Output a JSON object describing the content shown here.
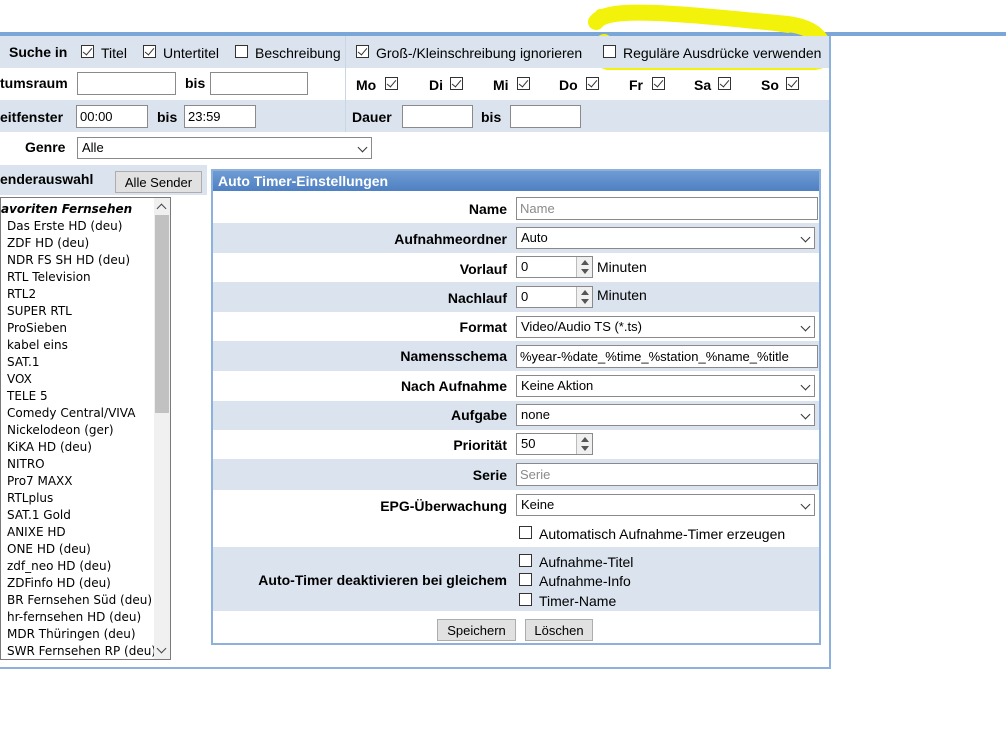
{
  "search": {
    "label": "Suche in",
    "options": [
      {
        "label": "Titel",
        "checked": true
      },
      {
        "label": "Untertitel",
        "checked": true
      },
      {
        "label": "Beschreibung",
        "checked": false
      }
    ],
    "case_label": "Groß-/Kleinschreibung ignorieren",
    "case_checked": true,
    "regex_label": "Reguläre Ausdrücke verwenden",
    "regex_checked": false
  },
  "date_range": {
    "label": "tumsraum",
    "to_label": "bis",
    "from_value": "",
    "to_value": ""
  },
  "weekdays": [
    {
      "label": "Mo",
      "checked": true
    },
    {
      "label": "Di",
      "checked": true
    },
    {
      "label": "Mi",
      "checked": true
    },
    {
      "label": "Do",
      "checked": true
    },
    {
      "label": "Fr",
      "checked": true
    },
    {
      "label": "Sa",
      "checked": true
    },
    {
      "label": "So",
      "checked": true
    }
  ],
  "time_window": {
    "label": "eitfenster",
    "from_value": "00:00",
    "to_label": "bis",
    "to_value": "23:59"
  },
  "duration": {
    "label": "Dauer",
    "to_label": "bis",
    "from_value": "",
    "to_value": ""
  },
  "genre": {
    "label": "Genre",
    "value": "Alle"
  },
  "channels": {
    "label": "enderauswahl",
    "all_button": "Alle Sender",
    "group": "avoriten Fernsehen",
    "items": [
      "Das Erste HD (deu)",
      "ZDF HD (deu)",
      "NDR FS SH HD (deu)",
      "RTL Television",
      "RTL2",
      "SUPER RTL",
      "ProSieben",
      "kabel eins",
      "SAT.1",
      "VOX",
      "TELE 5",
      "Comedy Central/VIVA",
      "Nickelodeon (ger)",
      "KiKA HD (deu)",
      "NITRO",
      "Pro7 MAXX",
      "RTLplus",
      "SAT.1 Gold",
      "ANIXE HD",
      "ONE HD (deu)",
      "zdf_neo HD (deu)",
      "ZDFinfo HD (deu)",
      "BR Fernsehen Süd (deu)",
      "hr-fernsehen HD (deu)",
      "MDR Thüringen (deu)",
      "SWR Fernsehen RP (deu)"
    ]
  },
  "panel": {
    "title": "Auto Timer-Einstellungen",
    "name": {
      "label": "Name",
      "placeholder": "Name",
      "value": ""
    },
    "folder": {
      "label": "Aufnahmeordner",
      "value": "Auto"
    },
    "pre": {
      "label": "Vorlauf",
      "value": "0",
      "unit": "Minuten"
    },
    "post": {
      "label": "Nachlauf",
      "value": "0",
      "unit": "Minuten"
    },
    "format": {
      "label": "Format",
      "value": "Video/Audio TS (*.ts)"
    },
    "naming": {
      "label": "Namensschema",
      "value": "%year-%date_%time_%station_%name_%title"
    },
    "after": {
      "label": "Nach Aufnahme",
      "value": "Keine Aktion"
    },
    "task": {
      "label": "Aufgabe",
      "value": "none"
    },
    "priority": {
      "label": "Priorität",
      "value": "50"
    },
    "series": {
      "label": "Serie",
      "placeholder": "Serie",
      "value": ""
    },
    "epg": {
      "label": "EPG-Überwachung",
      "value": "Keine"
    },
    "auto_create": {
      "label": "Automatisch Aufnahme-Timer erzeugen",
      "checked": false
    },
    "deactivate": {
      "label": "Auto-Timer deaktivieren bei gleichem",
      "options": [
        {
          "label": "Aufnahme-Titel",
          "checked": false
        },
        {
          "label": "Aufnahme-Info",
          "checked": false
        },
        {
          "label": "Timer-Name",
          "checked": false
        }
      ]
    },
    "save_button": "Speichern",
    "delete_button": "Löschen"
  },
  "colors": {
    "accent": "#4f80c2",
    "row_shade": "#dae3ee",
    "highlight": "#f2f20a"
  }
}
